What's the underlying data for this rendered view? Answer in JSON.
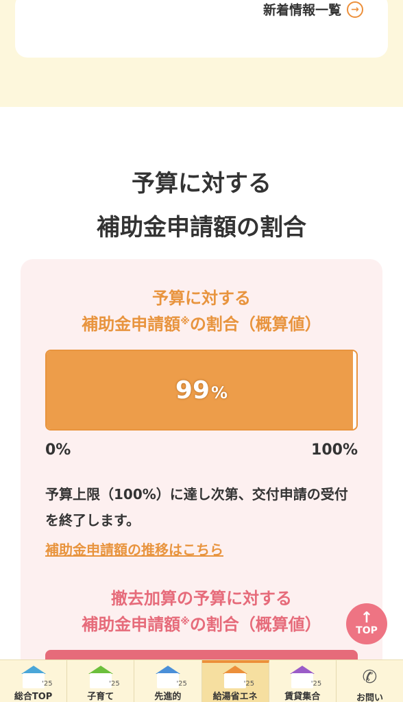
{
  "news": {
    "link_label": "新着情報一覧",
    "arrow_icon": "→"
  },
  "section": {
    "title_line1": "予算に対する",
    "title_line2": "補助金申請額の割合"
  },
  "budget_panel": {
    "heading_line1": "予算に対する",
    "heading_line2_a": "補助金申請額",
    "heading_mark": "※",
    "heading_line2_b": "の割合（概算値）",
    "percent_value": "99",
    "percent_unit": "%",
    "fill_fraction": 0.99,
    "scale_min": "0%",
    "scale_max": "100%",
    "note": "予算上限（100%）に達し次第、交付申請の受付を終了します。",
    "detail_link": "補助金申請額の推移はこちら"
  },
  "removal_panel": {
    "heading_line1": "撤去加算の予算に対する",
    "heading_line2_a": "補助金申請額",
    "heading_mark": "※",
    "heading_line2_b": "の割合（概算値）"
  },
  "top_button": {
    "arrow": "↑",
    "label": "TOP"
  },
  "bottom_nav": [
    {
      "label": "総合TOP",
      "icon": "house-icon",
      "glyph": "⌂",
      "color": "#4aa6d8",
      "year": "'25"
    },
    {
      "label": "子育て",
      "icon": "house-icon",
      "glyph": "✕",
      "color": "#6cbf3c",
      "year": "'25"
    },
    {
      "label": "先進的",
      "icon": "house-icon",
      "glyph": "▦",
      "color": "#4a8fd8",
      "year": "'25"
    },
    {
      "label": "給湯省エネ",
      "icon": "house-icon",
      "glyph": "♨",
      "color": "#ec8f3a",
      "year": "'25"
    },
    {
      "label": "賃貸集合",
      "icon": "house-icon",
      "glyph": "▭",
      "color": "#9a5cc8",
      "year": "'25"
    },
    {
      "label": "お問い",
      "icon": "phone-icon",
      "glyph": "✆"
    }
  ],
  "colors": {
    "accent": "#e8943e",
    "pink": "#e66b7a",
    "bar_fill": "#ed9d4a"
  }
}
